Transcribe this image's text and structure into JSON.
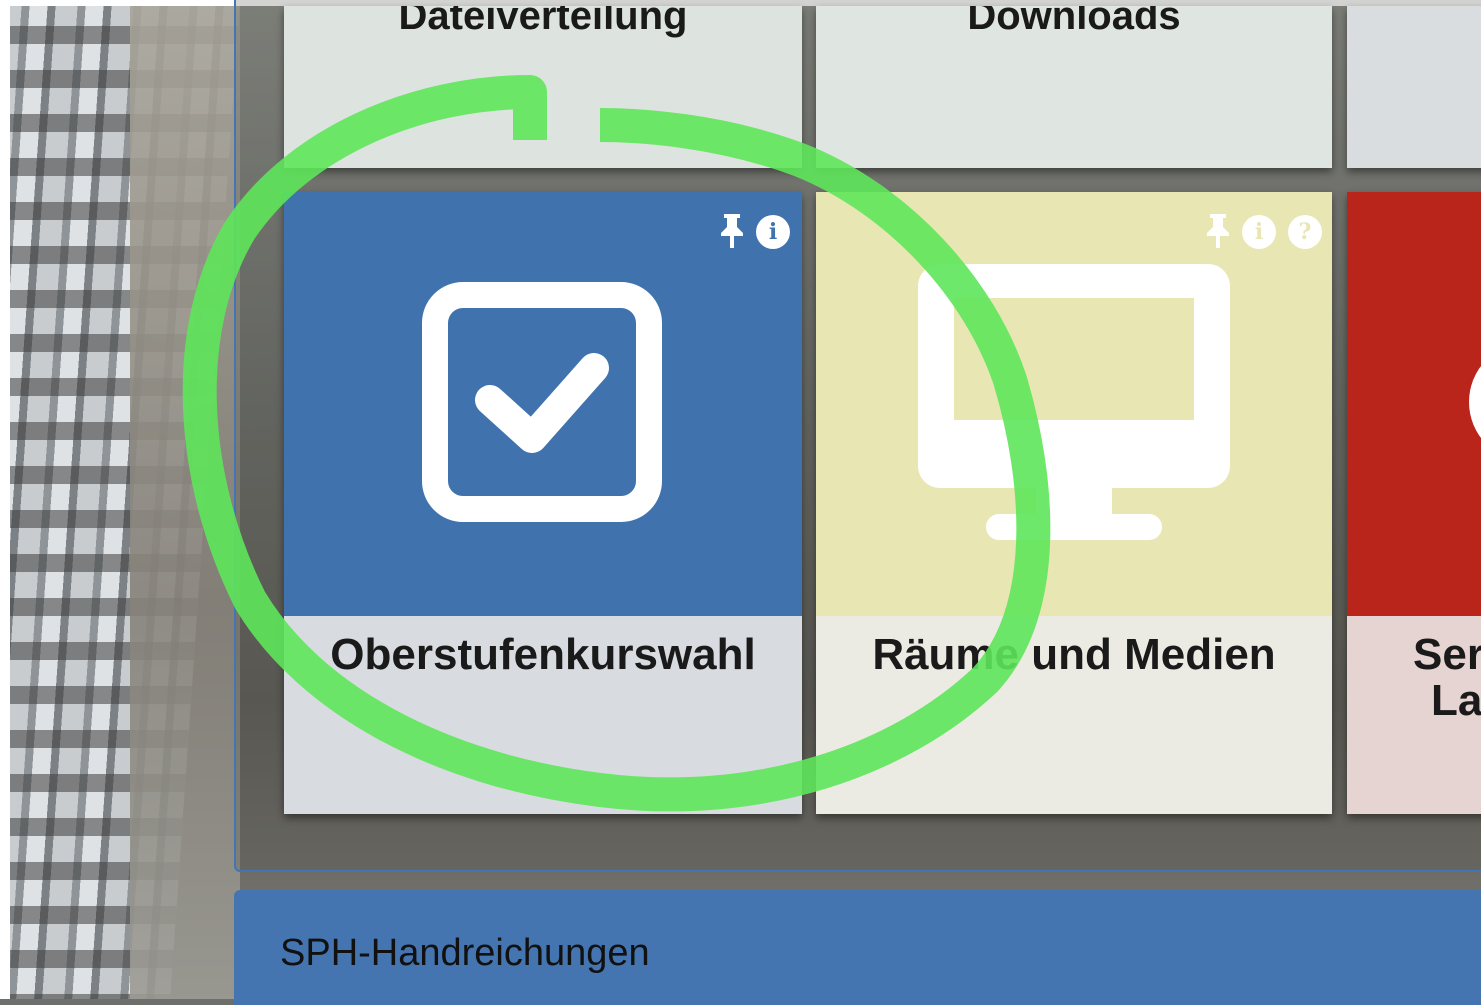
{
  "tiles_top": [
    {
      "label": "Dateiverteilung"
    },
    {
      "label": "Downloads"
    }
  ],
  "tiles": [
    {
      "title": "Oberstufenkurswahl",
      "icon": "checkbox-checked-icon",
      "header_color": "#4073ae",
      "footer_color": "#d8dce1",
      "badges": [
        "pin-icon",
        "info-icon"
      ]
    },
    {
      "title": "Räume und Medien",
      "icon": "monitor-icon",
      "header_color": "#e8e6b3",
      "footer_color": "#ecebe3",
      "badges": [
        "pin-icon",
        "info-icon",
        "help-icon"
      ]
    },
    {
      "title_line1": "Ser",
      "title_line2": "La",
      "header_color": "#b9251b",
      "footer_color": "#e6d4d3"
    }
  ],
  "badges": {
    "info": "i",
    "help": "?"
  },
  "footer_bar": {
    "label": "SPH-Handreichungen"
  },
  "colors": {
    "accent_blue": "#4475b0",
    "annotation_green": "#5ee65a"
  }
}
